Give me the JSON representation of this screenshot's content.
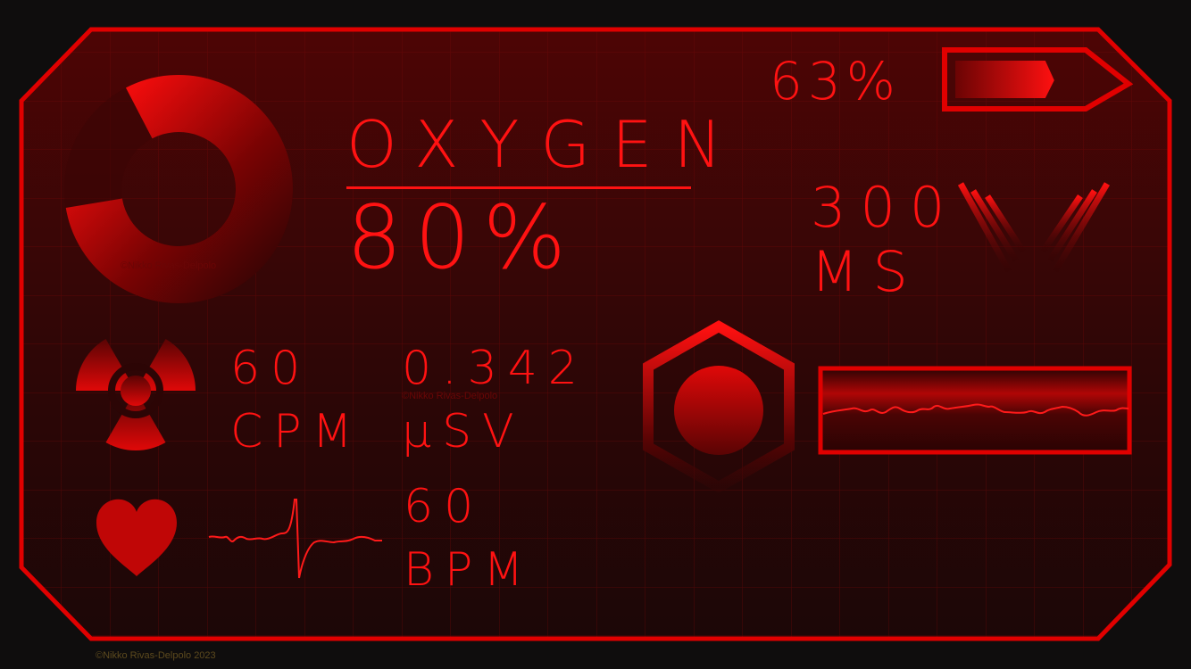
{
  "battery": {
    "label": "63%",
    "level": 0.63
  },
  "oxygen": {
    "label": "OXYGEN",
    "value": "80%",
    "level": 0.8
  },
  "latency": {
    "value": "300",
    "unit": "MS"
  },
  "radiation_cpm": {
    "value": "60",
    "unit": "CPM"
  },
  "radiation_dose": {
    "value": "0.342",
    "unit": "μSV"
  },
  "heart": {
    "value": "60",
    "unit": "BPM"
  },
  "watermarks": [
    "©Nikko Rivas-Delpolo",
    "©Nikko Rivas-Delpolo"
  ],
  "footer": {
    "credit": "©Nikko Rivas-Delpolo 2023"
  },
  "icons": [
    "radiation-icon",
    "heart-icon",
    "signal-icon",
    "hexagon-indicator-icon"
  ],
  "colors": {
    "accent": "#ff1212",
    "frame": "#e00000",
    "panel_top": "#4a0404",
    "panel_bottom": "#1a0606",
    "background": "#0f0d0d"
  }
}
